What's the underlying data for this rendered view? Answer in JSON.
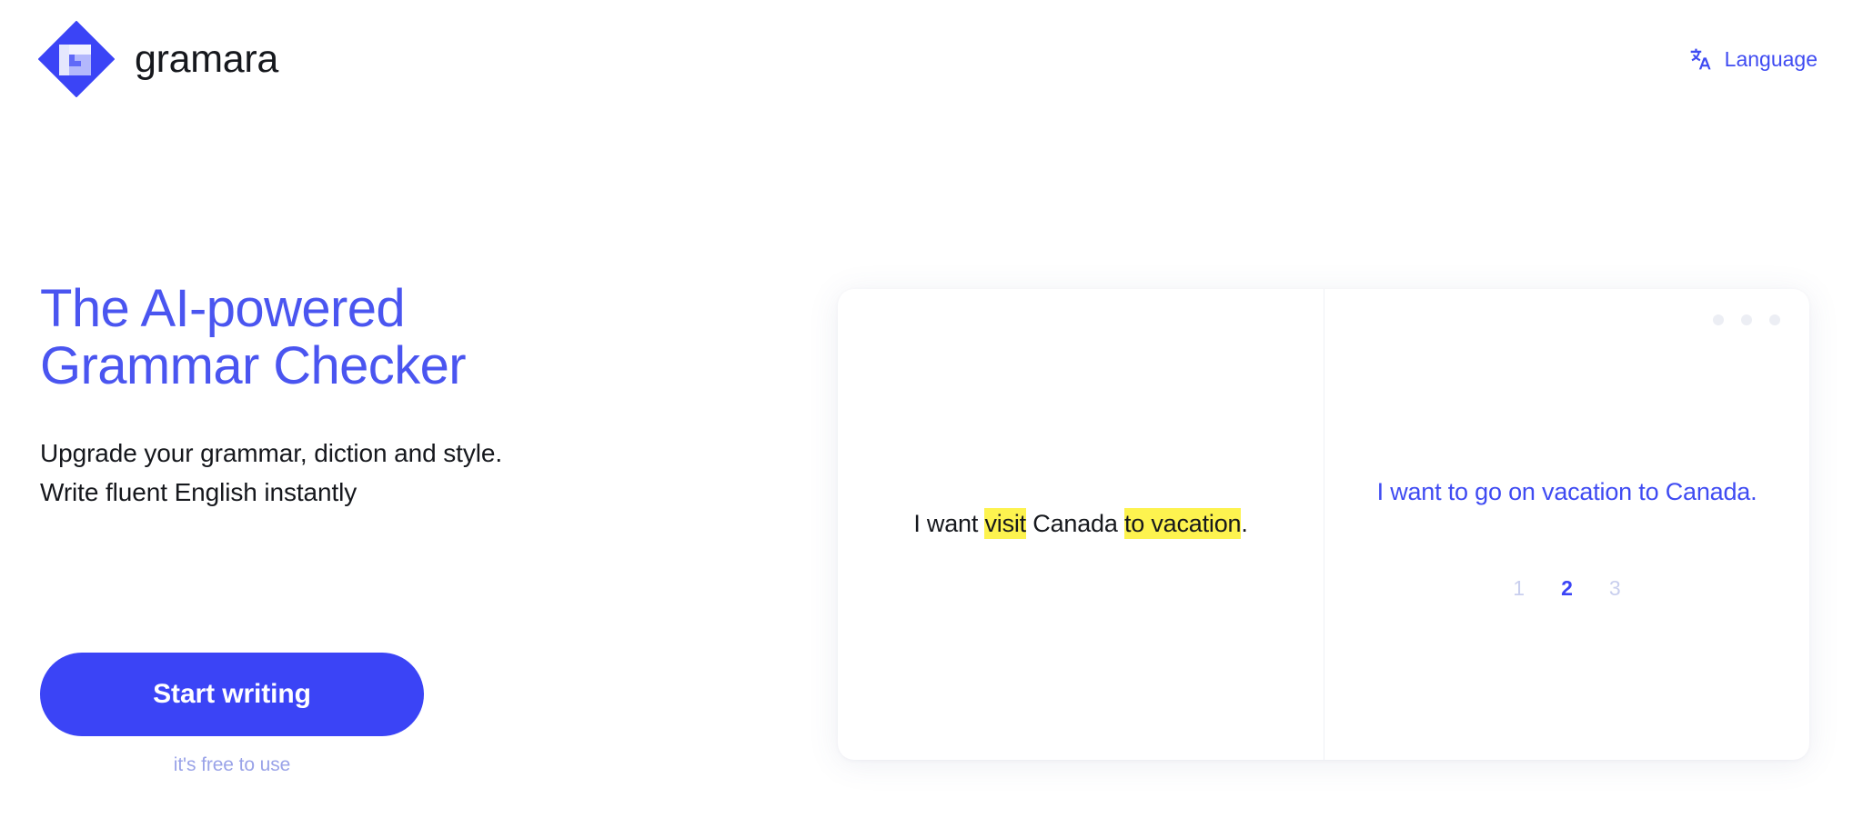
{
  "brand": {
    "name": "gramara",
    "logo_icon": "gramara-diamond-logo",
    "color": "#3b44f6"
  },
  "header": {
    "language_label": "Language",
    "language_icon": "translate-icon"
  },
  "hero": {
    "title_line1": "The AI-powered",
    "title_line2": "Grammar Checker",
    "subtitle_line1": "Upgrade your grammar, diction and style.",
    "subtitle_line2": "Write fluent English instantly",
    "cta_label": "Start writing",
    "cta_note": "it's free to use",
    "title_color": "#4a55f0"
  },
  "demo": {
    "input": {
      "part1": "I want ",
      "highlight1": "visit",
      "part2": " Canada ",
      "highlight2": "to vacation",
      "part3": "."
    },
    "output": {
      "sentence": "I want to go on vacation to Canada.",
      "color": "#3f4bf2"
    },
    "pager": {
      "items": [
        "1",
        "2",
        "3"
      ],
      "active_index": 1
    },
    "dots_icon": "three-dots-indicator",
    "highlight_color": "#fdf34f"
  }
}
